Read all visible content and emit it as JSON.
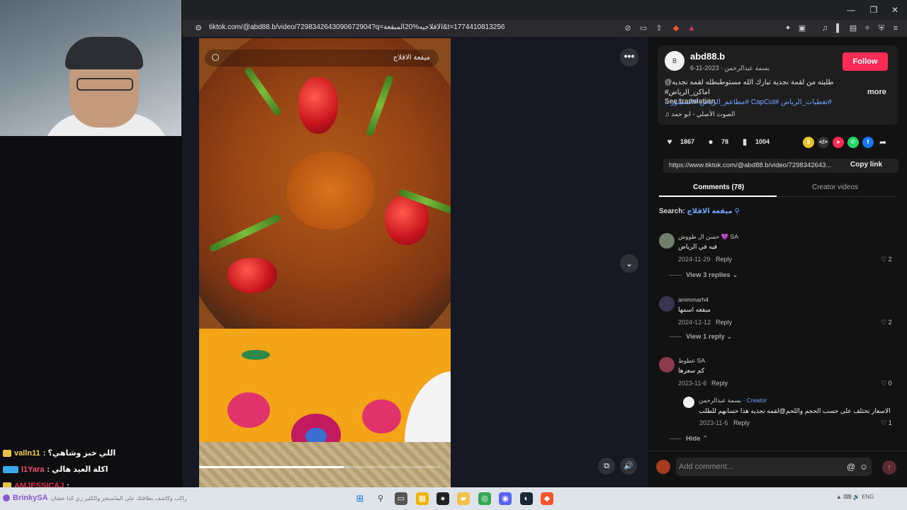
{
  "browser": {
    "url": "tiktok.com/@abd88.b/video/7298342643090672904?q=الاقلاجيه%20المبقعة&t=1774410813256"
  },
  "stream_chat": [
    {
      "user": "valln11",
      "message": ": اللي خبز وشاهي؟"
    },
    {
      "user": "l1Yara",
      "message": ": اكلة العيد هالي"
    },
    {
      "user": "AMJESSICAJ",
      "message": ":"
    }
  ],
  "taskbar": {
    "streamer": "BrinkySA",
    "streamer_message": "راكب وكاشف بطاقتك على الماسنجر والكثير زي كذا عشان"
  },
  "video": {
    "search_overlay": "ميقعة الاقلاج",
    "progress": 0.6
  },
  "post": {
    "avatar_text": "B",
    "author": "abd88.b",
    "author_display": "بسمة عبدالرحمن",
    "date": "2023-11-6",
    "follow_label": "Follow",
    "desc_line1": "طلبته من لقمة نجدية تبارك الله مستوطنطله لقمه نجديه@ اماكن_الرياض#",
    "desc_line2": "#تغطيات_الرياض #CapCut #مطاعم_الرياض #اكسبلور...",
    "more_label": "more",
    "see_translation": "See translation",
    "music": "♫ الصوت الأصلي - ابو حمد"
  },
  "stats": {
    "likes": "1867",
    "comments": "78",
    "saves": "1004"
  },
  "share_link": {
    "url": "https://www.tiktok.com/@abd88.b/video/7298342643...",
    "copy_label": "Copy link"
  },
  "tabs": {
    "comments": "Comments (78)",
    "creator_videos": "Creator videos"
  },
  "comment_search": {
    "label": "Search:",
    "keyword": "ميقعة الاقلاج"
  },
  "comments": [
    {
      "user": "حسن ال طووش 💜 SA",
      "text": "فيه في الرياض",
      "date": "2024-11-29",
      "reply": "Reply",
      "likes": "2",
      "view_replies": "View 3 replies"
    },
    {
      "user": "ammmarh4",
      "text": "ميقعه اسمها",
      "date": "2024-12-12",
      "reply": "Reply",
      "likes": "2",
      "view_replies": "View 1 reply"
    },
    {
      "user": "عطوط SA",
      "text": "كم سعرها",
      "date": "2023-11-6",
      "reply": "Reply",
      "likes": "0"
    }
  ],
  "creator_reply": {
    "user": "بسمة عبدالرحمن",
    "tag": "· Creator",
    "text": "الاسعار تختلف على حسب الحجم واللحم@لقمه نجديه هذا حسابهم للطلب",
    "date": "2023-11-6",
    "reply": "Reply",
    "likes": "1",
    "hide": "Hide"
  },
  "comment_input": {
    "placeholder": "Add comment..."
  }
}
